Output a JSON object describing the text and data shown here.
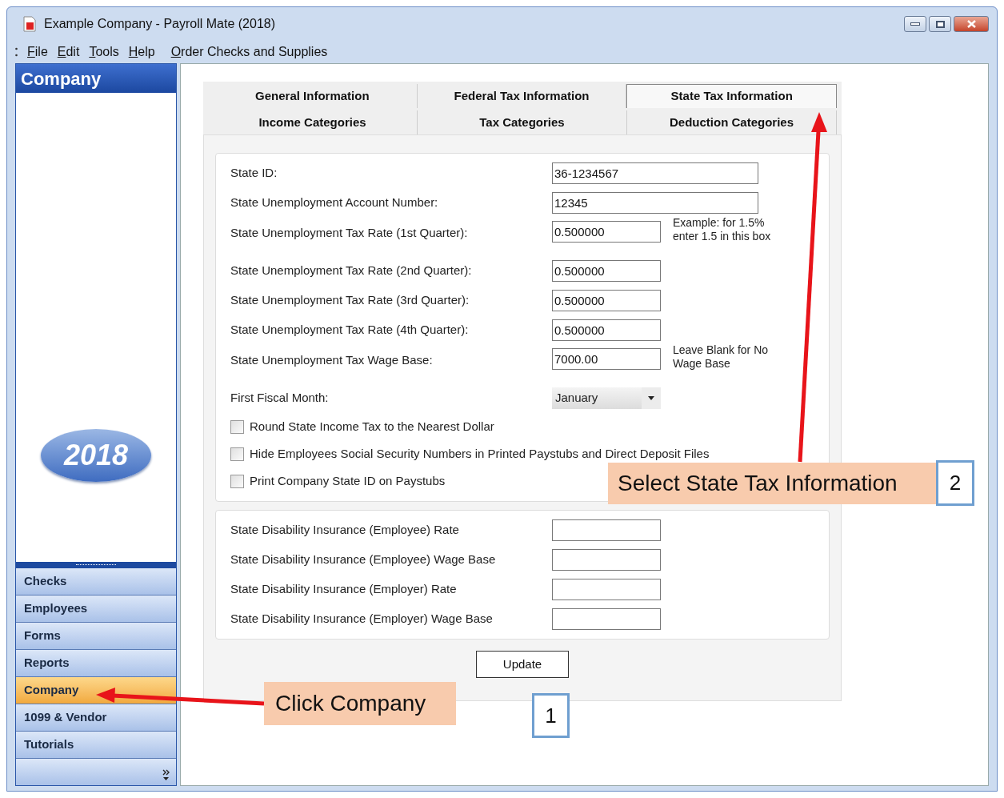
{
  "window": {
    "title": "Example Company - Payroll Mate (2018)"
  },
  "menu": [
    {
      "label": "File"
    },
    {
      "label": "Edit"
    },
    {
      "label": "Tools"
    },
    {
      "label": "Help"
    },
    {
      "label": "Order Checks and Supplies"
    }
  ],
  "sidebar": {
    "title": "Company",
    "logo": "2018",
    "items": [
      {
        "label": "Checks",
        "selected": false
      },
      {
        "label": "Employees",
        "selected": false
      },
      {
        "label": "Forms",
        "selected": false
      },
      {
        "label": "Reports",
        "selected": false
      },
      {
        "label": "Company",
        "selected": true
      },
      {
        "label": "1099 & Vendor",
        "selected": false
      },
      {
        "label": "Tutorials",
        "selected": false
      }
    ]
  },
  "tabs": [
    [
      {
        "label": "General Information",
        "selected": false
      },
      {
        "label": "Federal Tax Information",
        "selected": false
      },
      {
        "label": "State Tax Information",
        "selected": true
      }
    ],
    [
      {
        "label": "Income Categories",
        "selected": false
      },
      {
        "label": "Tax Categories",
        "selected": false
      },
      {
        "label": "Deduction Categories",
        "selected": false
      }
    ]
  ],
  "state_fields": [
    {
      "kind": "entry",
      "label": "State ID:",
      "value": "36-1234567"
    },
    {
      "kind": "entry",
      "label": "State Unemployment Account Number:",
      "value": "12345"
    },
    {
      "kind": "number",
      "label": "State Unemployment Tax Rate (1st Quarter):",
      "value": "0.500000",
      "note": "Example: for 1.5% enter 1.5 in this box"
    },
    {
      "kind": "number",
      "label": "State Unemployment Tax Rate (2nd Quarter):",
      "value": "0.500000"
    },
    {
      "kind": "number",
      "label": "State Unemployment Tax Rate (3rd Quarter):",
      "value": "0.500000"
    },
    {
      "kind": "number",
      "label": "State Unemployment Tax Rate (4th Quarter):",
      "value": "0.500000"
    },
    {
      "kind": "number",
      "label": "State Unemployment Tax Wage Base:",
      "value": "7000.00",
      "note": "Leave Blank for No Wage Base"
    },
    {
      "kind": "select",
      "label": "First Fiscal Month:",
      "value": "January"
    }
  ],
  "options": [
    {
      "label": "Round State Income Tax to the Nearest Dollar",
      "checked": false
    },
    {
      "label": "Hide Employees Social Security Numbers in Printed Paystubs and Direct Deposit Files",
      "checked": false
    },
    {
      "label": "Print Company State ID on Paystubs",
      "checked": false
    }
  ],
  "disability_fields": [
    {
      "label": "State Disability Insurance (Employee) Rate"
    },
    {
      "label": "State Disability Insurance (Employee) Wage Base"
    },
    {
      "label": "State Disability Insurance (Employer) Rate"
    },
    {
      "label": "State Disability Insurance (Employer) Wage Base"
    }
  ],
  "update_button": "Update",
  "callouts": [
    {
      "text": "Click Company",
      "number": "1"
    },
    {
      "text": "Select State Tax Information",
      "number": "2"
    }
  ]
}
